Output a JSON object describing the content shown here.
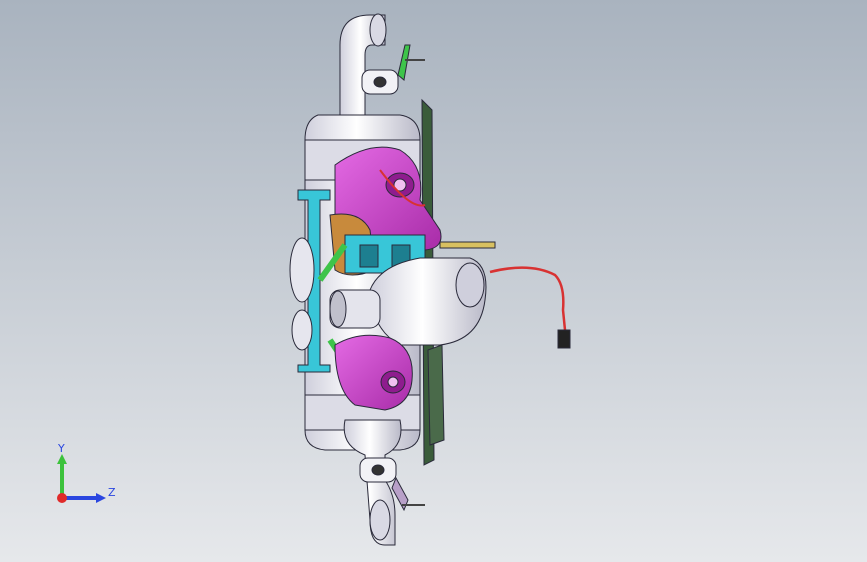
{
  "viewport": {
    "background_top": "#a9b3bf",
    "background_bottom": "#e6e8eb"
  },
  "model": {
    "colors": {
      "housing": "#e9e9ef",
      "housing_shade": "#c8c8d4",
      "outline": "#2a2a3a",
      "magenta": "#d24bd2",
      "magenta_dark": "#8e1c8e",
      "cyan": "#38c6d8",
      "cyan_dark": "#1d7f90",
      "green": "#3ec44a",
      "wire_red": "#d83232",
      "copper": "#c88a3c",
      "dark_green_plate": "#3a5c3a"
    }
  },
  "triad": {
    "y_label": "Y",
    "z_label": "Z",
    "y_color": "#3cc23c",
    "z_color": "#2a46e0",
    "x_color": "#e02a2a"
  }
}
